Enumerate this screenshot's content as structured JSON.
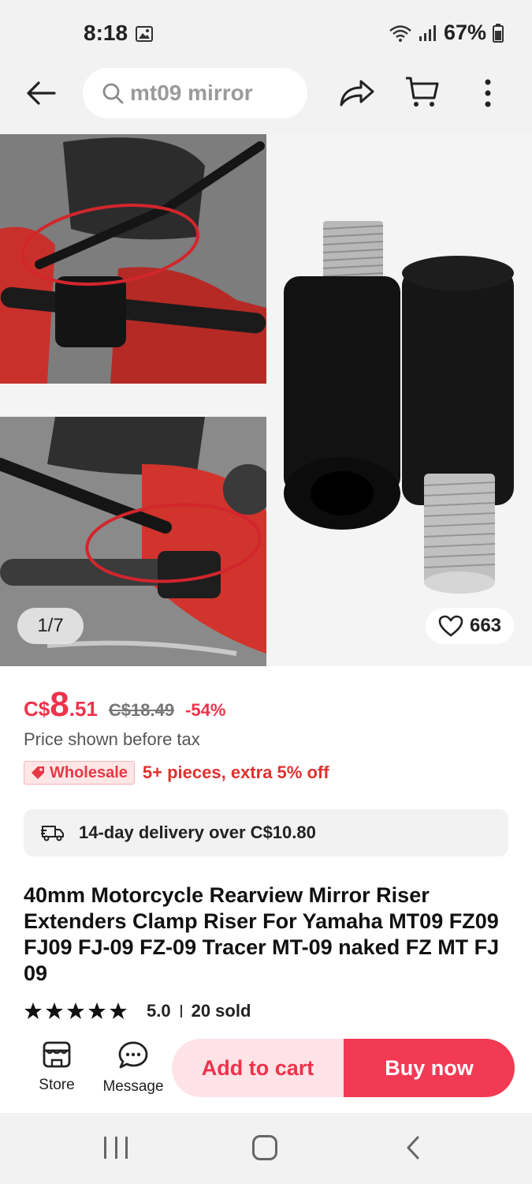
{
  "status_bar": {
    "time": "8:18",
    "battery": "67%",
    "icons": [
      "image-icon",
      "wifi-icon",
      "signal-icon",
      "battery-icon"
    ]
  },
  "top_nav": {
    "search_query": "mt09 mirror",
    "icons": [
      "back-arrow-icon",
      "search-icon",
      "share-icon",
      "cart-icon",
      "more-vertical-icon"
    ]
  },
  "gallery": {
    "page_indicator": "1/7",
    "likes": "663",
    "icons": [
      "heart-icon"
    ]
  },
  "price": {
    "currency_symbol": "C$",
    "integer": "8",
    "decimal": ".51",
    "original": "C$18.49",
    "discount": "-54%",
    "tax_note": "Price shown before tax"
  },
  "wholesale": {
    "badge_label": "Wholesale",
    "offer": "5+ pieces, extra 5% off"
  },
  "delivery": {
    "text": "14-day delivery over C$10.80"
  },
  "product": {
    "title": "40mm Motorcycle Rearview Mirror Riser Extenders Clamp Riser For Yamaha MT09 FZ09 FJ09 FJ-09 FZ-09 Tracer MT-09 naked FZ MT FJ 09",
    "rating": "5.0",
    "sold": "20 sold",
    "star_count": 5
  },
  "actions": {
    "store_label": "Store",
    "message_label": "Message",
    "add_to_cart_label": "Add to cart",
    "buy_now_label": "Buy now"
  },
  "colors": {
    "accent": "#f0324a",
    "buy_now_bg": "#f23a55",
    "add_cart_bg": "#ffe3e6"
  }
}
